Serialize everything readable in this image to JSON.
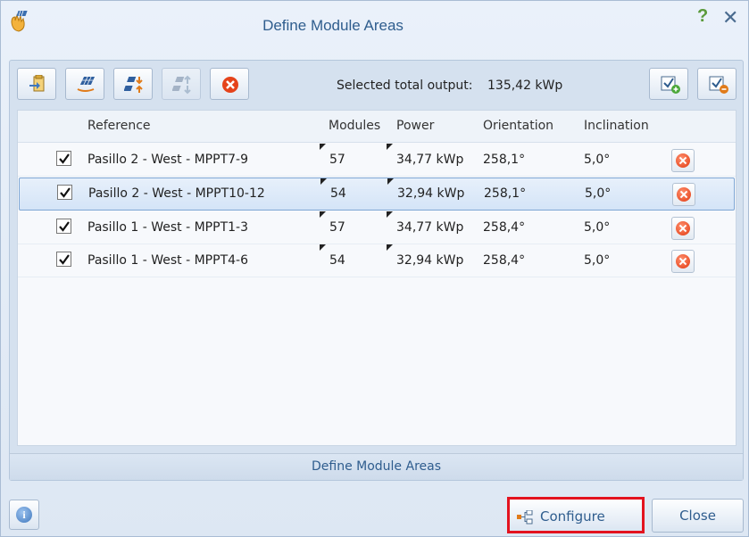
{
  "window": {
    "title": "Define Module Areas",
    "help_label": "?",
    "close_label": "✕"
  },
  "toolbar": {
    "selected_label": "Selected total output:",
    "selected_value": "135,42 kWp"
  },
  "grid": {
    "columns": {
      "reference": "Reference",
      "modules": "Modules",
      "power": "Power",
      "orientation": "Orientation",
      "inclination": "Inclination"
    },
    "rows": [
      {
        "reference": "Pasillo 2 - West - MPPT7-9",
        "modules": "57",
        "power": "34,77 kWp",
        "orientation": "258,1°",
        "inclination": "5,0°",
        "checked": true,
        "selected": false
      },
      {
        "reference": "Pasillo 2 - West - MPPT10-12",
        "modules": "54",
        "power": "32,94 kWp",
        "orientation": "258,1°",
        "inclination": "5,0°",
        "checked": true,
        "selected": true
      },
      {
        "reference": "Pasillo 1 - West - MPPT1-3",
        "modules": "57",
        "power": "34,77 kWp",
        "orientation": "258,4°",
        "inclination": "5,0°",
        "checked": true,
        "selected": false
      },
      {
        "reference": "Pasillo 1 - West - MPPT4-6",
        "modules": "54",
        "power": "32,94 kWp",
        "orientation": "258,4°",
        "inclination": "5,0°",
        "checked": true,
        "selected": false
      }
    ]
  },
  "panel_footer": "Define Module Areas",
  "buttons": {
    "info": "i",
    "configure": "Configure",
    "close": "Close"
  },
  "colors": {
    "accent_text": "#2f5d8e",
    "highlight_border": "#e3131f",
    "delete_red": "#e23a12"
  },
  "icons": {
    "app": "solar-hand-icon",
    "import": "import-icon",
    "solar_panel": "solar-panel-icon",
    "merge": "merge-areas-icon",
    "split": "split-areas-icon",
    "delete": "delete-icon",
    "check_add": "checklist-add-icon",
    "check_remove": "checklist-remove-icon",
    "info": "info-icon",
    "configure": "configure-icon"
  }
}
